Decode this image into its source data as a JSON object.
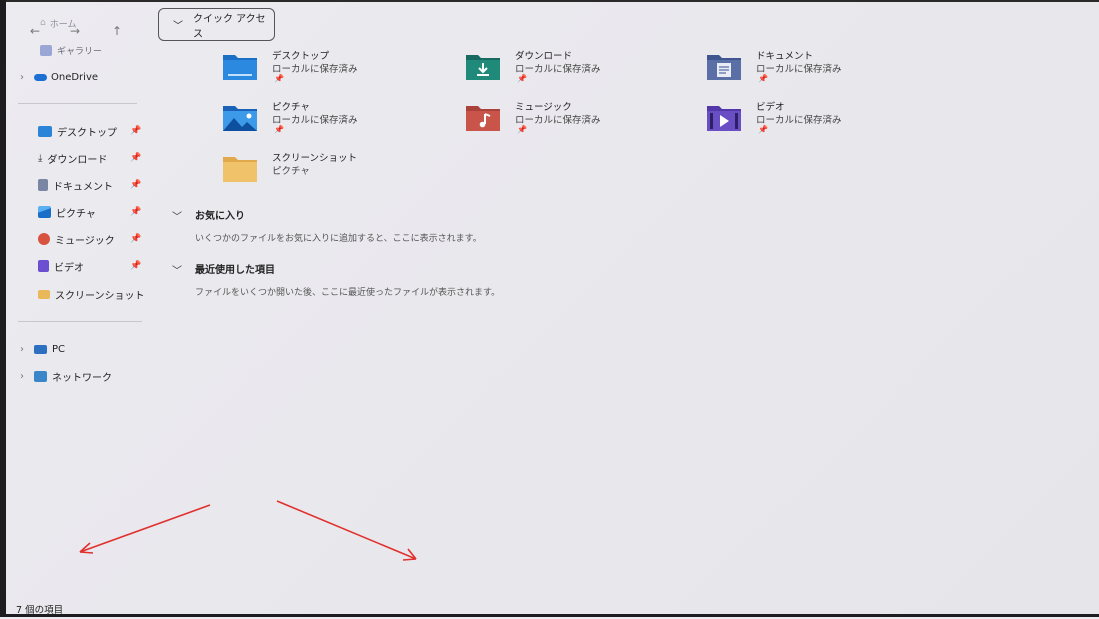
{
  "sidebar": {
    "home": "ホーム",
    "gallery": "ギャラリー",
    "onedrive": "OneDrive",
    "pinned": [
      {
        "label": "デスクトップ",
        "icon": "desktop-icon"
      },
      {
        "label": "ダウンロード",
        "icon": "download-icon"
      },
      {
        "label": "ドキュメント",
        "icon": "document-icon"
      },
      {
        "label": "ピクチャ",
        "icon": "pictures-icon"
      },
      {
        "label": "ミュージック",
        "icon": "music-icon"
      },
      {
        "label": "ビデオ",
        "icon": "video-icon"
      },
      {
        "label": "スクリーンショット",
        "icon": "folder-icon"
      }
    ],
    "pc": "PC",
    "network": "ネットワーク",
    "pin_glyph": "📌"
  },
  "nav": {
    "back": "←",
    "forward": "→",
    "up": "↑"
  },
  "main": {
    "quick_access": "クイック アクセス",
    "tiles": [
      {
        "name": "デスクトップ",
        "sub": "ローカルに保存済み",
        "pinned": true
      },
      {
        "name": "ダウンロード",
        "sub": "ローカルに保存済み",
        "pinned": true
      },
      {
        "name": "ドキュメント",
        "sub": "ローカルに保存済み",
        "pinned": true
      },
      {
        "name": "ピクチャ",
        "sub": "ローカルに保存済み",
        "pinned": true
      },
      {
        "name": "ミュージック",
        "sub": "ローカルに保存済み",
        "pinned": true
      },
      {
        "name": "ビデオ",
        "sub": "ローカルに保存済み",
        "pinned": true
      },
      {
        "name": "スクリーンショット",
        "sub": "ピクチャ",
        "pinned": false
      }
    ],
    "favorites": {
      "title": "お気に入り",
      "message": "いくつかのファイルをお気に入りに追加すると、ここに表示されます。"
    },
    "recent": {
      "title": "最近使用した項目",
      "message": "ファイルをいくつか開いた後、ここに最近使ったファイルが表示されます。"
    }
  },
  "status": {
    "item_count": "7 個の項目"
  },
  "colors": {
    "annotation_arrow": "#e0312f",
    "folder_blue": "#2b7fd8",
    "folder_teal": "#1f8a7a",
    "folder_slate": "#5a6fa6",
    "folder_red": "#c8544a",
    "folder_purple": "#6a4fc4",
    "folder_yellow": "#f0c36b"
  }
}
